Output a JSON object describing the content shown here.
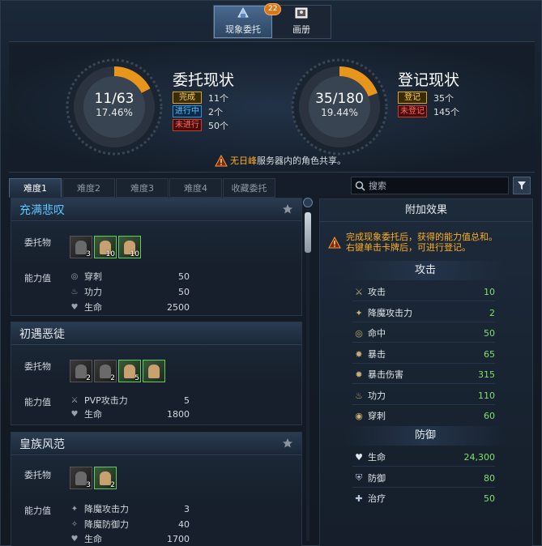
{
  "top_tabs": [
    {
      "label": "现象委托",
      "badge": "22",
      "active": true
    },
    {
      "label": "画册",
      "active": false
    }
  ],
  "commission_status": {
    "title": "委托现状",
    "count": "11/63",
    "percent": "17.46%",
    "fraction": 0.1746,
    "legend": [
      {
        "tag": "完成",
        "count": "11个"
      },
      {
        "tag": "进行中",
        "count": "2个"
      },
      {
        "tag": "未进行",
        "count": "50个"
      }
    ]
  },
  "register_status": {
    "title": "登记现状",
    "count": "35/180",
    "percent": "19.44%",
    "fraction": 0.1944,
    "legend": [
      {
        "tag": "登记",
        "count": "35个"
      },
      {
        "tag": "未登记",
        "count": "145个"
      }
    ]
  },
  "notice": {
    "server": "无日峰",
    "text": "服务器内的角色共享。"
  },
  "difficulty_tabs": [
    "难度1",
    "难度2",
    "难度3",
    "难度4",
    "收藏委托"
  ],
  "search": {
    "placeholder": "搜索"
  },
  "labels": {
    "commission": "委托物",
    "ability": "能力值"
  },
  "commissions": [
    {
      "title": "充满悲叹",
      "cards": [
        {
          "count": "3",
          "green": false
        },
        {
          "count": "10",
          "green": true
        },
        {
          "count": "10",
          "green": true
        }
      ],
      "stats": [
        {
          "icon": "pierce-icon",
          "name": "穿刺",
          "value": "50"
        },
        {
          "icon": "power-icon",
          "name": "功力",
          "value": "50"
        },
        {
          "icon": "heart-icon",
          "name": "生命",
          "value": "2500"
        }
      ]
    },
    {
      "title": "初遇恶徒",
      "cards": [
        {
          "count": "2",
          "green": false
        },
        {
          "count": "2",
          "green": false
        },
        {
          "count": "5",
          "green": true
        },
        {
          "count": "",
          "green": true
        }
      ],
      "stats": [
        {
          "icon": "pvp-icon",
          "name": "PVP攻击力",
          "value": "5"
        },
        {
          "icon": "heart-icon",
          "name": "生命",
          "value": "1800"
        }
      ]
    },
    {
      "title": "皇族风范",
      "cards": [
        {
          "count": "3",
          "green": false
        },
        {
          "count": "2",
          "green": true
        }
      ],
      "stats": [
        {
          "icon": "demon-attack-icon",
          "name": "降魔攻击力",
          "value": "3"
        },
        {
          "icon": "demon-defense-icon",
          "name": "降魔防御力",
          "value": "40"
        },
        {
          "icon": "heart-icon",
          "name": "生命",
          "value": "1700"
        }
      ]
    }
  ],
  "effects": {
    "title": "附加效果",
    "notice_line1": "完成现象委托后，获得的能力值总和。",
    "notice_line2": "右键单击卡牌后，可进行登记。",
    "attack_title": "攻击",
    "attack": [
      {
        "icon": "attack-icon",
        "name": "攻击",
        "value": "10"
      },
      {
        "icon": "demon-attack-icon",
        "name": "降魔攻击力",
        "value": "2"
      },
      {
        "icon": "accuracy-icon",
        "name": "命中",
        "value": "50"
      },
      {
        "icon": "critical-icon",
        "name": "暴击",
        "value": "65"
      },
      {
        "icon": "critical-damage-icon",
        "name": "暴击伤害",
        "value": "315"
      },
      {
        "icon": "power-icon",
        "name": "功力",
        "value": "110"
      },
      {
        "icon": "pierce-icon",
        "name": "穿刺",
        "value": "60"
      }
    ],
    "defense_title": "防御",
    "defense": [
      {
        "icon": "heart-icon",
        "name": "生命",
        "value": "24,300"
      },
      {
        "icon": "shield-icon",
        "name": "防御",
        "value": "80"
      },
      {
        "icon": "heal-icon",
        "name": "治疗",
        "value": "50"
      }
    ]
  }
}
